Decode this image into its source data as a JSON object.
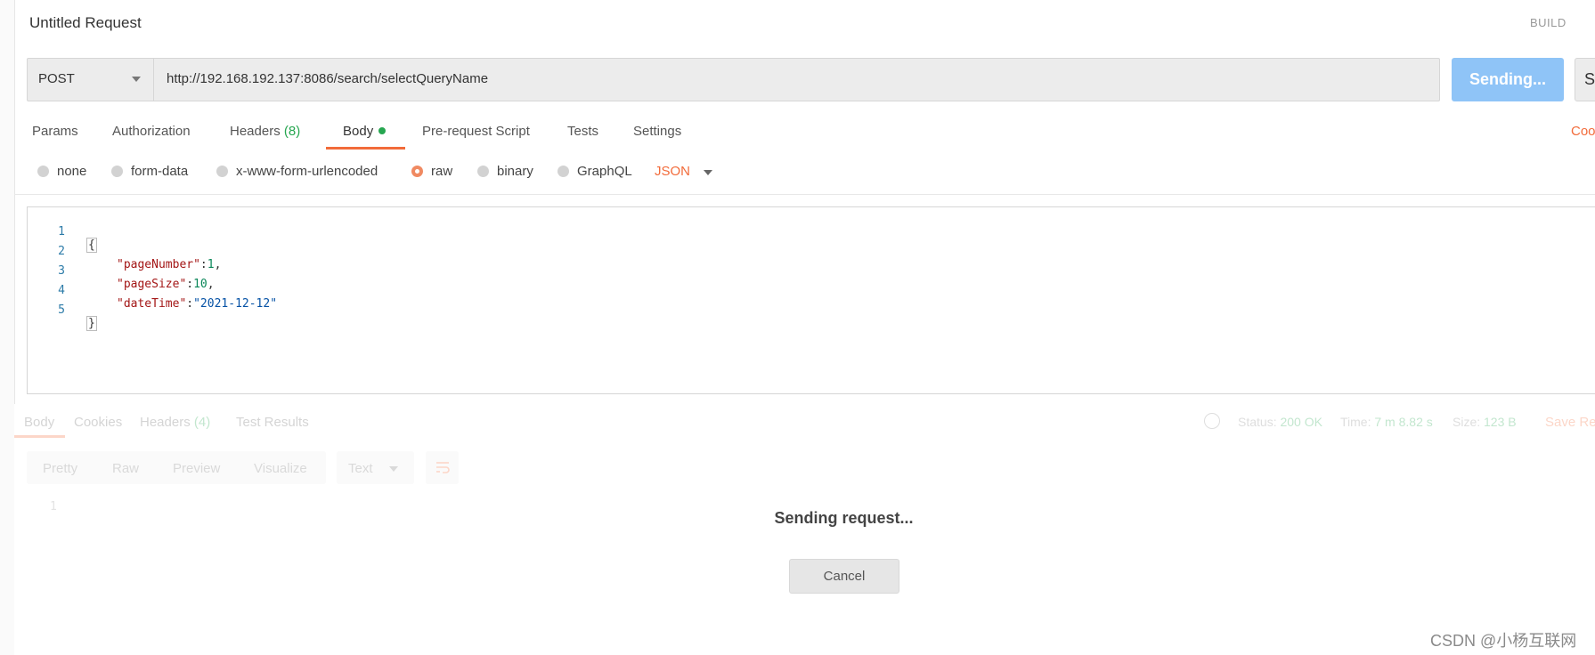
{
  "rail": {
    "glyph_a": "|",
    "glyph_b": "&#xE8;"
  },
  "header": {
    "title": "Untitled Request",
    "build": "BUILD"
  },
  "request": {
    "method": "POST",
    "url": "http://192.168.192.137:8086/search/selectQueryName",
    "send_label": "Sending...",
    "save_label": "Sa"
  },
  "tabs": {
    "params": "Params",
    "authorization": "Authorization",
    "headers": "Headers",
    "headers_count": "(8)",
    "body": "Body",
    "pre_request": "Pre-request Script",
    "tests": "Tests",
    "settings": "Settings",
    "cookies": "Coo"
  },
  "body_modes": {
    "none": "none",
    "form_data": "form-data",
    "urlencoded": "x-www-form-urlencoded",
    "raw": "raw",
    "binary": "binary",
    "graphql": "GraphQL",
    "selected": "raw",
    "language": "JSON"
  },
  "editor": {
    "line_numbers": [
      "1",
      "2",
      "3",
      "4",
      "5"
    ],
    "open_brace": "{",
    "close_brace": "}",
    "entries": [
      {
        "key": "\"pageNumber\"",
        "sep": ":",
        "value": "1",
        "tail": ","
      },
      {
        "key": "\"pageSize\"",
        "sep": ":",
        "value": "10",
        "tail": ","
      },
      {
        "key": "\"dateTime\"",
        "sep": ":",
        "value": "\"2021-12-12\"",
        "tail": ""
      }
    ]
  },
  "response": {
    "tabs": {
      "body": "Body",
      "cookies": "Cookies",
      "headers": "Headers",
      "headers_count": "(4)",
      "test_results": "Test Results"
    },
    "status_label": "Status:",
    "status_value": "200 OK",
    "time_label": "Time:",
    "time_value": "7 m 8.82 s",
    "size_label": "Size:",
    "size_value": "123 B",
    "save_label": "Save Re",
    "formats": {
      "pretty": "Pretty",
      "raw": "Raw",
      "preview": "Preview",
      "visualize": "Visualize"
    },
    "text_select": "Text",
    "line_number": "1",
    "sending_message": "Sending request...",
    "cancel_label": "Cancel"
  },
  "watermark": "CSDN @小杨互联网",
  "colors": {
    "accent": "#f26b3a",
    "send": "#8fc4f7",
    "count": "#26a650"
  }
}
